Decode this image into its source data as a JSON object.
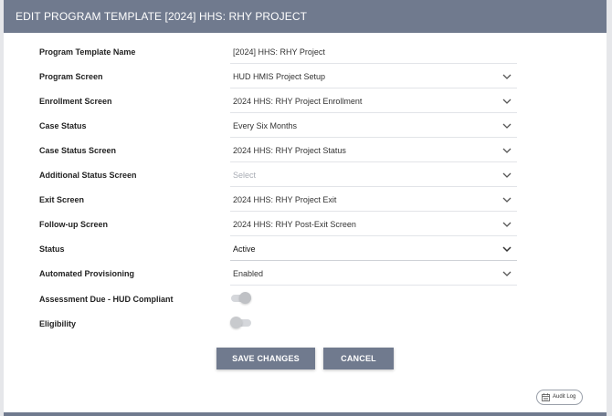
{
  "header": {
    "title": "EDIT PROGRAM TEMPLATE [2024] HHS: RHY PROJECT"
  },
  "form": {
    "rows": [
      {
        "label": "Program Template Name",
        "value": "[2024] HHS: RHY Project"
      },
      {
        "label": "Program Screen",
        "value": "HUD HMIS Project Setup"
      },
      {
        "label": "Enrollment Screen",
        "value": "2024 HHS: RHY Project Enrollment"
      },
      {
        "label": "Case Status",
        "value": "Every Six Months"
      },
      {
        "label": "Case Status Screen",
        "value": "2024 HHS: RHY Project Status"
      },
      {
        "label": "Additional Status Screen",
        "placeholder": "Select"
      },
      {
        "label": "Exit Screen",
        "value": "2024 HHS: RHY Project Exit"
      },
      {
        "label": "Follow-up Screen",
        "value": "2024 HHS: RHY Post-Exit Screen"
      },
      {
        "label": "Status",
        "value": "Active"
      },
      {
        "label": "Automated Provisioning",
        "value": "Enabled"
      }
    ],
    "toggles": [
      {
        "label": "Assessment Due - HUD Compliant",
        "on": true
      },
      {
        "label": "Eligibility",
        "on": false
      }
    ]
  },
  "actions": {
    "save_label": "SAVE CHANGES",
    "cancel_label": "CANCEL"
  },
  "audit": {
    "label": "Audit Log"
  },
  "colors": {
    "header_bg": "#707a8e",
    "button_bg": "#707a8e",
    "page_bg": "#e6e7ea"
  }
}
